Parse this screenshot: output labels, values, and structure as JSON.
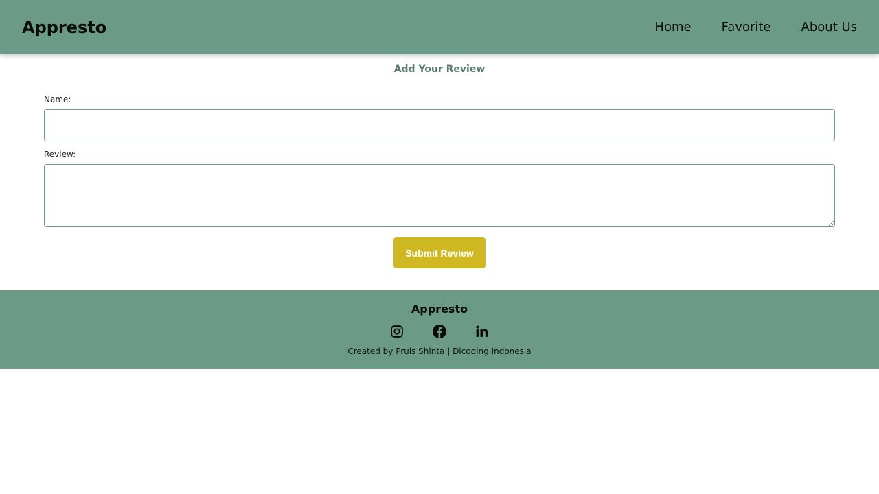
{
  "header": {
    "brand": "Appresto",
    "nav": [
      {
        "label": "Home"
      },
      {
        "label": "Favorite"
      },
      {
        "label": "About Us"
      }
    ]
  },
  "review_form": {
    "title": "Add Your Review",
    "name_label": "Name:",
    "name_value": "",
    "review_label": "Review:",
    "review_value": "",
    "submit_label": "Submit Review"
  },
  "footer": {
    "brand": "Appresto",
    "social_icons": [
      "instagram-icon",
      "facebook-icon",
      "linkedin-icon"
    ],
    "credit": "Created by Pruis Shinta | Dicoding Indonesia"
  },
  "colors": {
    "primary": "#6b9b88",
    "accent": "#d0b822",
    "title": "#5b7f6e"
  }
}
